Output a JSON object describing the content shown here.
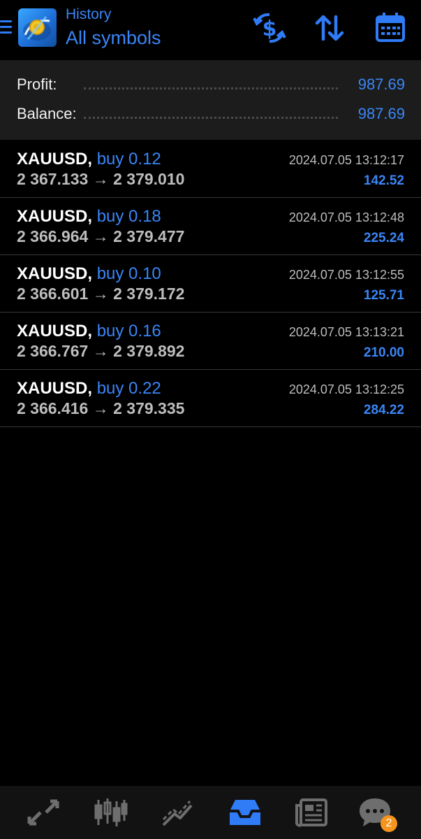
{
  "header": {
    "title_small": "History",
    "title_big": "All symbols",
    "accent_color": "#3a86f7",
    "icons": [
      "menu-icon",
      "app-logo",
      "currency-swap-icon",
      "sort-icon",
      "calendar-icon"
    ]
  },
  "summary": {
    "profit_label": "Profit:",
    "profit_value": "987.69",
    "balance_label": "Balance:",
    "balance_value": "987.69"
  },
  "deals": [
    {
      "symbol": "XAUUSD,",
      "type": "buy 0.12",
      "prices": "2 367.133 → 2 379.010",
      "time": "2024.07.05 13:12:17",
      "profit": "142.52"
    },
    {
      "symbol": "XAUUSD,",
      "type": "buy 0.18",
      "prices": "2 366.964 → 2 379.477",
      "time": "2024.07.05 13:12:48",
      "profit": "225.24"
    },
    {
      "symbol": "XAUUSD,",
      "type": "buy 0.10",
      "prices": "2 366.601 → 2 379.172",
      "time": "2024.07.05 13:12:55",
      "profit": "125.71"
    },
    {
      "symbol": "XAUUSD,",
      "type": "buy 0.16",
      "prices": "2 366.767 → 2 379.892",
      "time": "2024.07.05 13:13:21",
      "profit": "210.00"
    },
    {
      "symbol": "XAUUSD,",
      "type": "buy 0.22",
      "prices": "2 366.416 → 2 379.335",
      "time": "2024.07.05 13:12:25",
      "profit": "284.22"
    }
  ],
  "bottom_nav": {
    "items": [
      "quotes-icon",
      "chart-icon",
      "trade-icon",
      "history-icon",
      "news-icon",
      "chat-icon"
    ],
    "active": "history-icon",
    "chat_badge": "2",
    "badge_color": "#f7941d"
  }
}
